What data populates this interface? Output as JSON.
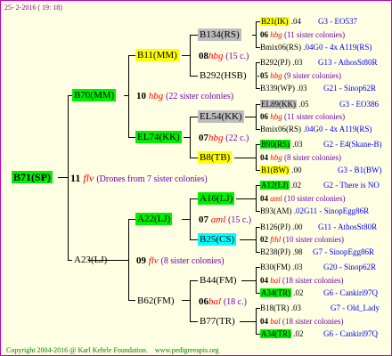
{
  "header": {
    "date": "25-  2-2016  ( 19: 18)"
  },
  "footer": {
    "copyright": "Copyright 2004-2016 @ Karl Kehrle Foundation.",
    "url": "www.pedigreeapis.org"
  },
  "root": {
    "label": "B71(SP)",
    "gen": "11",
    "sym": "flv",
    "note": "(Drones from 7 sister colonies)"
  },
  "p1": {
    "label": "B70(MM)",
    "gen": "10",
    "sym": "hbg",
    "note": "(22 sister colonies)"
  },
  "p2": {
    "label": "A23(LJ)",
    "gen": "09",
    "sym": "flv",
    "note": "(8 sister colonies)"
  },
  "n_b11": {
    "label": "B11(MM)",
    "gen": "08",
    "sym": "hbg",
    "note": "(15 c.)"
  },
  "n_el74": {
    "label": "EL74(KK)",
    "gen": "07",
    "sym": "hbg",
    "note": "(22 c.)"
  },
  "n_a22": {
    "label": "A22(LJ)",
    "gen": "07",
    "sym": "aml",
    "note": "(15 c.)"
  },
  "n_b62": {
    "label": "B62(FM)",
    "gen": "06",
    "sym": "bal",
    "note": "(18 c.)"
  },
  "q_b134": {
    "label": "B134(RS)",
    "gen": "06",
    "sym": "hbg",
    "note": "(11 sister colonies)"
  },
  "q_b292": {
    "label": "B292(HSB)",
    "gen": "05",
    "sym": "hbg",
    "note": "(9 sister colonies)"
  },
  "q_el54": {
    "label": "EL54(KK)",
    "gen": "06",
    "sym": "hbg",
    "note": "(11 sister colonies)"
  },
  "q_b8": {
    "label": "B8(TB)",
    "gen": "04",
    "sym": "hbg",
    "note": "(8 sister colonies)"
  },
  "q_a16": {
    "label": "A16(LJ)",
    "gen": "04",
    "sym": "aml",
    "note": "(10 sister colonies)"
  },
  "q_b25": {
    "label": "B25(CS)",
    "gen": "02",
    "sym": "fthl",
    "note": "(10 sister colonies)"
  },
  "q_b44": {
    "label": "B44(FM)",
    "gen": "04",
    "sym": "bal",
    "note": "(18 sister colonies)"
  },
  "q_b77": {
    "label": "B77(TR)",
    "gen": "04",
    "sym": "bal",
    "note": "(18 sister colonies)"
  },
  "leaves": [
    {
      "label": "B21(IK)",
      "val": ".04",
      "right": "G3 - EO537"
    },
    {
      "label": "Bmix06(RS)",
      "val": ".04G0 - 4x A119(RS)",
      "right": ""
    },
    {
      "label": "B292(PJ)",
      "val": ".03",
      "right": "G13 - AthosSt80R"
    },
    {
      "label": "B339(WP)",
      "val": ".03",
      "right": "G21 - Sinop62R"
    },
    {
      "label": "EL89(KK)",
      "val": ".05",
      "right": "G3 - EO386"
    },
    {
      "label": "Bmix06(RS)",
      "val": ".04G0 - 4x A119(RS)",
      "right": ""
    },
    {
      "label": "B90(RS)",
      "val": ".03",
      "right": "G2 - E4(Skane-B)"
    },
    {
      "label": "B1(BW)",
      "val": ".00",
      "right": "G3 - B1(BW)"
    },
    {
      "label": "A12(LJ)",
      "val": ".02",
      "right": "G2 - There is NO"
    },
    {
      "label": "B93(AM)",
      "val": ".02G11 - SinopEgg86R",
      "right": ""
    },
    {
      "label": "B126(PJ)",
      "val": ".00",
      "right": "G11 - AthosSt80R"
    },
    {
      "label": "B238(PJ)",
      "val": ".98",
      "right": "G7 - SinopEgg86R"
    },
    {
      "label": "B30(FM)",
      "val": ".03",
      "right": "G20 - Sinop62R"
    },
    {
      "label": "A34(TR)",
      "val": ".02",
      "right": "G6 - Cankiri97Q"
    },
    {
      "label": "B18(TR)",
      "val": ".03",
      "right": "G7 - Old_Lady"
    },
    {
      "label": "A34(TR)",
      "val": ".02",
      "right": "G6 - Cankiri97Q"
    }
  ]
}
